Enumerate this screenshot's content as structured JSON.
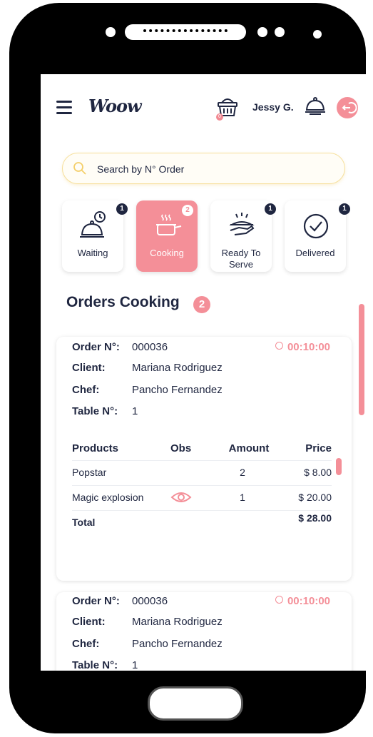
{
  "header": {
    "logo": "Woow",
    "user_name": "Jessy G.",
    "cart_count": "0"
  },
  "search": {
    "placeholder": "Search by N° Order"
  },
  "tabs": [
    {
      "label": "Waiting",
      "badge": "1"
    },
    {
      "label": "Cooking",
      "badge": "2"
    },
    {
      "label": "Ready To Serve",
      "badge": "1"
    },
    {
      "label": "Delivered",
      "badge": "1"
    }
  ],
  "section": {
    "title": "Orders Cooking",
    "count": "2"
  },
  "labels": {
    "order_no": "Order N°:",
    "client": "Client:",
    "chef": "Chef:",
    "table_no": "Table N°:",
    "products": "Products",
    "obs": "Obs",
    "amount": "Amount",
    "price": "Price",
    "total": "Total"
  },
  "orders": [
    {
      "order_no": "000036",
      "timer": "00:10:00",
      "client": "Mariana Rodriguez",
      "chef": "Pancho Fernandez",
      "table_no": "1",
      "products": [
        {
          "name": "Popstar",
          "amount": "2",
          "price": "$  8.00"
        },
        {
          "name": "Magic explosion",
          "amount": "1",
          "price": "$ 20.00"
        }
      ],
      "total": "$ 28.00"
    },
    {
      "order_no": "000036",
      "timer": "00:10:00",
      "client": "Mariana Rodriguez",
      "chef": "Pancho Fernandez",
      "table_no": "1"
    }
  ],
  "colors": {
    "accent": "#f48f98",
    "navy": "#1f2640",
    "search_border": "#f6df9a"
  }
}
